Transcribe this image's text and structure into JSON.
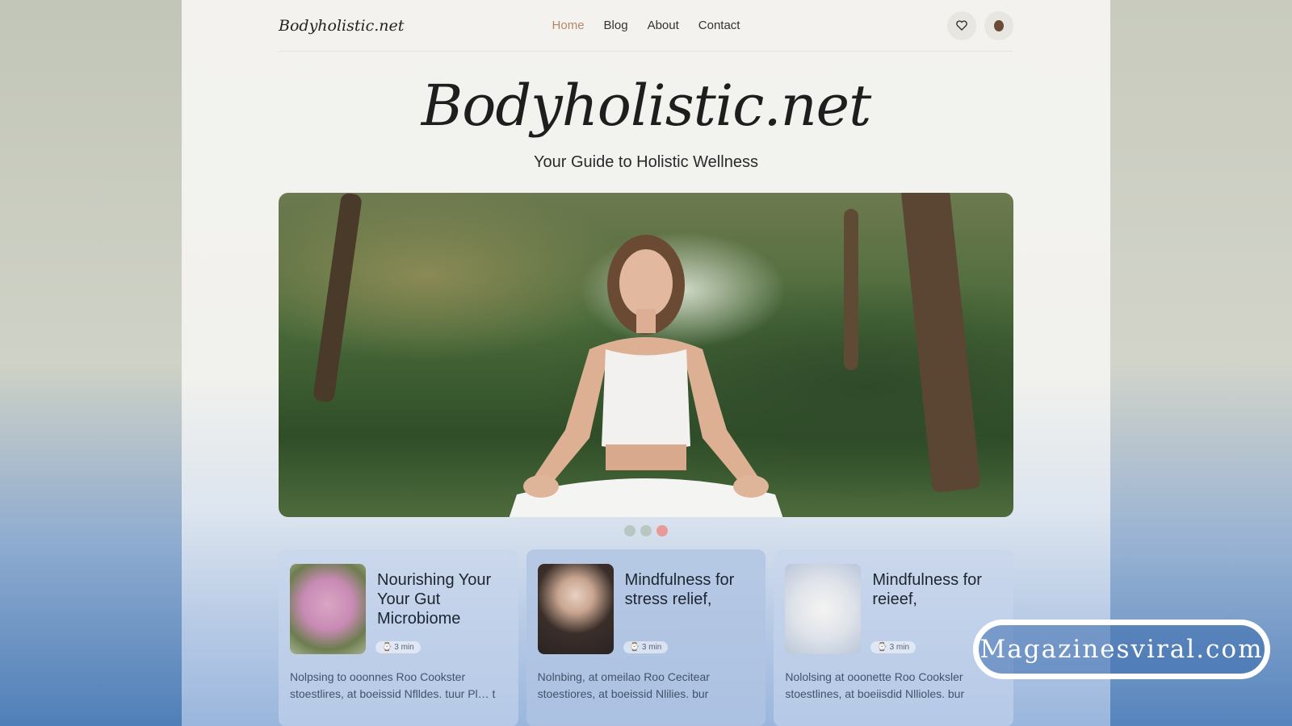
{
  "site": {
    "logo_small": "Bodyholistic.net",
    "title": "Bodyholistic.net",
    "tagline": "Your Guide to Holistic Wellness"
  },
  "nav": {
    "items": [
      {
        "label": "Home",
        "active": true
      },
      {
        "label": "Blog",
        "active": false
      },
      {
        "label": "About",
        "active": false
      },
      {
        "label": "Contact",
        "active": false
      }
    ],
    "icons": [
      "heart-icon",
      "avatar"
    ]
  },
  "hero": {
    "image_alt": "Woman meditating in a park",
    "carousel": {
      "count": 3,
      "active_index": 2
    }
  },
  "cards": [
    {
      "title": "Nourishing Your Your Gut Microbiome",
      "meta": "⌚ 3 min",
      "thumb": "gut",
      "excerpt": "Nolpsing to ooonnes Roo Cookster stoestlires, at boeissid Nflldes. tuur Pl… t"
    },
    {
      "title": "Mindfulness for stress relief,",
      "meta": "⌚ 3 min",
      "thumb": "face",
      "excerpt": "Nolnbing, at omeilao Roo Cecitear stoestiores, at boeissid Nlilies. bur"
    },
    {
      "title": "Mindfulness for reieef,",
      "meta": "⌚ 3 min",
      "thumb": "hands",
      "excerpt": "Nololsing at ooonette Roo Cooksler stoestlines, at boeiisdid Nllioles. bur"
    }
  ],
  "watermark": "Magazinesviral.com",
  "colors": {
    "accent": "#b5876a",
    "dot_active": "#e79a98",
    "dot_inactive": "#b9c6c2"
  }
}
